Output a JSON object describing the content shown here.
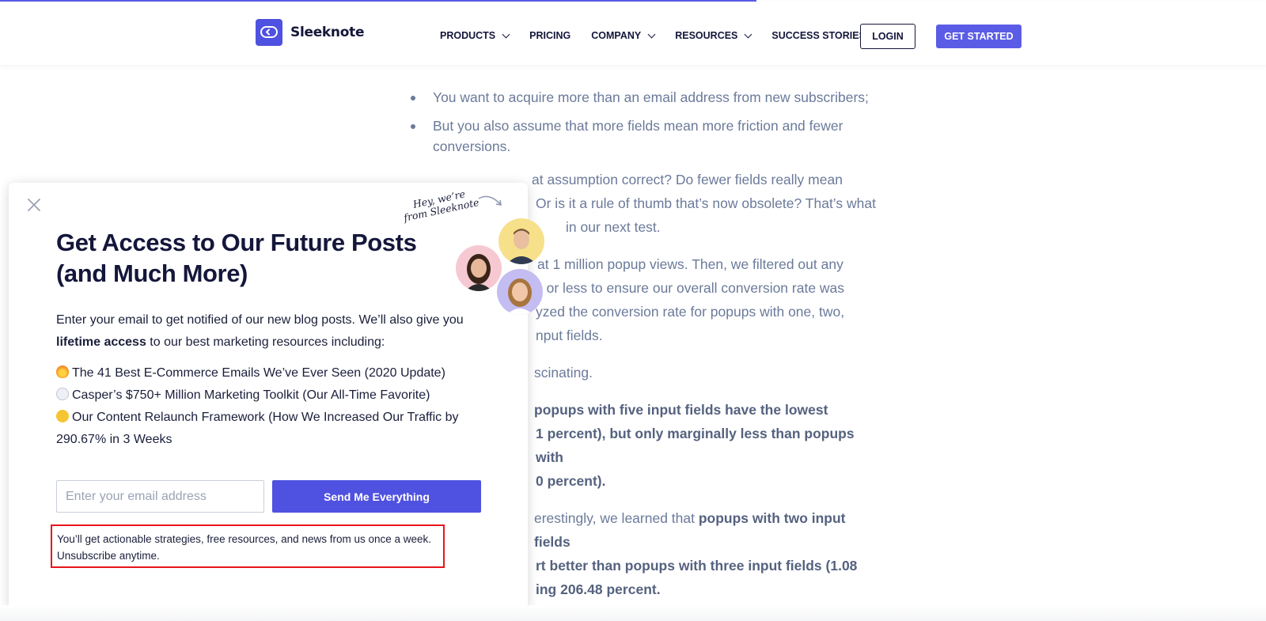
{
  "progress": {
    "fraction": 0.5972
  },
  "header": {
    "brand": "Sleeknote",
    "nav": [
      {
        "label": "PRODUCTS",
        "dropdown": true
      },
      {
        "label": "PRICING",
        "dropdown": false
      },
      {
        "label": "COMPANY",
        "dropdown": true
      },
      {
        "label": "RESOURCES",
        "dropdown": true
      },
      {
        "label": "SUCCESS STORIES",
        "dropdown": false
      }
    ],
    "login_label": "LOGIN",
    "cta_label": "GET STARTED"
  },
  "article": {
    "bullets": [
      "You want to acquire more than an email address from new subscribers;",
      "But you also assume that more fields mean more friction and fewer conversions."
    ],
    "p1": "at assumption correct? Do fewer fields really mean Or is it a rule of thumb that’s now obsolete? That’s what in our next test.",
    "p1_lines": [
      "at assumption correct? Do fewer fields really mean",
      "Or is it a rule of thumb that’s now obsolete? That’s what",
      "in our next test."
    ],
    "p2_lines": [
      "at 1 million popup views. Then, we filtered out any",
      "s or less to ensure our overall conversion rate was",
      "yzed the conversion rate for popups with one, two,",
      "nput fields."
    ],
    "p3": "scinating.",
    "p4_lines": [
      "popups with five input fields have the lowest",
      "1 percent), but only marginally less than popups with",
      "0 percent)."
    ],
    "p5_line1_normal": "erestingly, we learned that ",
    "p5_line1_bold": "popups with two input fields",
    "p5_lines_bold": [
      "rt better than popups with three input fields (1.08",
      "ing 206.48 percent."
    ]
  },
  "popup": {
    "close_icon": "close-icon",
    "hey_line1": "Hey, we’re",
    "hey_line2": "from Sleeknote",
    "title": "Get Access to Our Future Posts (and Much More)",
    "intro_part1": "Enter your email to get notified of our new blog posts. We’ll also give you ",
    "intro_bold": "lifetime access",
    "intro_part2": " to our best marketing resources including:",
    "resources": [
      {
        "icon": "fire-emoji-icon",
        "text": "The 41 Best E-Commerce Emails We’ve Ever Seen (2020 Update)"
      },
      {
        "icon": "ghost-emoji-icon",
        "text": "Casper’s $750+ Million Marketing Toolkit (Our All-Time Favorite)"
      },
      {
        "icon": "money-face-emoji-icon",
        "text": "Our Content Relaunch Framework (How We Increased Our Traffic by 290.67% in 3 Weeks"
      }
    ],
    "email_placeholder": "Enter your email address",
    "send_label": "Send Me Everything",
    "disclaimer": "You’ll get actionable strategies, free resources, and news from us once a week. Unsubscribe anytime."
  },
  "colors": {
    "accent": "#4f51e0",
    "highlight_border": "#e8141a",
    "article_text": "#6b7a9a",
    "heading": "#14163a"
  }
}
